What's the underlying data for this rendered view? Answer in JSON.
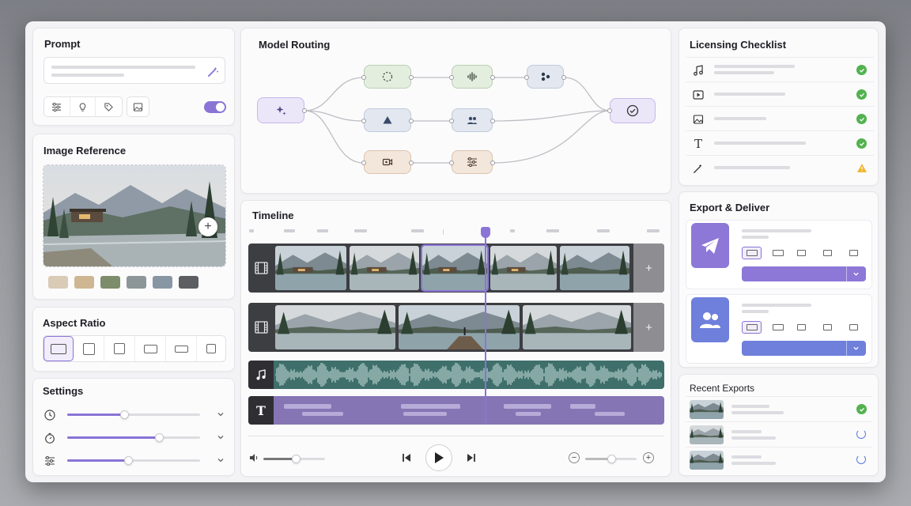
{
  "prompt": {
    "title": "Prompt",
    "toggle_on": true,
    "accent": "#8a74d6"
  },
  "image_reference": {
    "title": "Image Reference",
    "swatches": [
      "#d9cbb6",
      "#cfb693",
      "#7d8c6b",
      "#8c9597",
      "#8896a3",
      "#5c5e61"
    ]
  },
  "aspect_ratio": {
    "title": "Aspect Ratio",
    "selected_index": 0
  },
  "settings": {
    "title": "Settings",
    "sliders": [
      {
        "icon": "clock-icon",
        "value": 0.43
      },
      {
        "icon": "timer-icon",
        "value": 0.69
      },
      {
        "icon": "sliders-icon",
        "value": 0.46
      }
    ]
  },
  "model_routing": {
    "title": "Model Routing"
  },
  "timeline": {
    "title": "Timeline",
    "playhead_fraction": 0.57,
    "volume": 0.53,
    "zoom": 0.5,
    "waveform_color": "#3e6f6b",
    "text_track_color": "#8675b4"
  },
  "licensing": {
    "title": "Licensing Checklist",
    "items": [
      {
        "icon": "music-note-icon",
        "status": "ok"
      },
      {
        "icon": "video-play-icon",
        "status": "ok"
      },
      {
        "icon": "image-icon",
        "status": "ok"
      },
      {
        "icon": "text-icon",
        "status": "ok"
      },
      {
        "icon": "magic-wand-icon",
        "status": "warning"
      }
    ]
  },
  "export": {
    "title": "Export & Deliver",
    "targets": [
      {
        "icon": "send-icon",
        "color": "#8d78d8"
      },
      {
        "icon": "users-icon",
        "color": "#6f7fdc"
      }
    ]
  },
  "recent_exports": {
    "title": "Recent Exports",
    "items": [
      {
        "status": "done"
      },
      {
        "status": "loading"
      },
      {
        "status": "loading"
      }
    ]
  }
}
